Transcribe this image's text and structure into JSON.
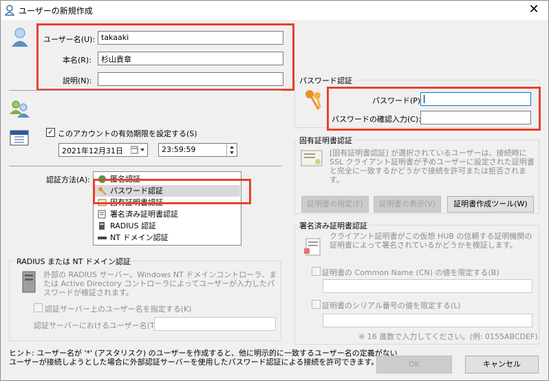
{
  "window": {
    "title": "ユーザーの新規作成",
    "close_label": "✕"
  },
  "user": {
    "username_label": "ユーザー名(U):",
    "username_value": "takaaki",
    "fullname_label": "本名(R):",
    "fullname_value": "杉山貴章",
    "note_label": "説明(N):",
    "note_value": ""
  },
  "expiry": {
    "checkbox_label": "このアカウントの有効期限を設定する(S)",
    "checked": "✓",
    "date_value": "2021年12月31日",
    "time_value": "23:59:59"
  },
  "auth": {
    "label": "認証方法(A):",
    "items": [
      {
        "label": "匿名認証"
      },
      {
        "label": "パスワード認証"
      },
      {
        "label": "固有証明書認証"
      },
      {
        "label": "署名済み証明書認証"
      },
      {
        "label": "RADIUS 認証"
      },
      {
        "label": "NT ドメイン認証"
      }
    ],
    "selected_index": 1
  },
  "radius": {
    "group_title": "RADIUS または NT ドメイン認証",
    "description": "外部の RADIUS サーバー、Windows NT ドメインコントローラ、または Active Directory コントローラによってユーザーが入力したパスワードが検証されます。",
    "checkbox_label": "認証サーバー上のユーザー名を指定する(K)",
    "server_user_label": "認証サーバーにおけるユーザー名(T):",
    "server_user_value": ""
  },
  "password": {
    "group_title": "パスワード認証",
    "password_label": "パスワード(P):",
    "password_value": "",
    "confirm_label": "パスワードの確認入力(C):",
    "confirm_value": ""
  },
  "cert": {
    "group_title": "固有証明書認証",
    "description": "[固有証明書認証] が選択されているユーザーは、接続時に SSL クライアント証明書が予めユーザーに設定された証明書と完全に一致するかどうかで接続を許可または拒否されます。",
    "specify_button": "証明書の指定(E)",
    "view_button": "証明書の表示(V)",
    "tool_button": "証明書作成ツール(W)"
  },
  "signed": {
    "group_title": "署名済み証明書認証",
    "description": "クライアント証明書がこの仮想 HUB の信頼する証明機関の証明書によって署名されているかどうかを検証します。",
    "cn_checkbox_label": "証明書の Common Name (CN) の値を限定する(B)",
    "cn_value": "",
    "serial_checkbox_label": "証明書のシリアル番号の値を限定する(L)",
    "serial_value": "",
    "serial_hint": "※ 16 進数で入力してください。(例: 0155ABCDEF)"
  },
  "hint": {
    "line1": "ヒント: ユーザー名が '*' (アスタリスク) のユーザーを作成すると、他に明示的に一致するユーザー名の定義がない",
    "line2": "ユーザーが接続しようとした場合に外部認証サーバーを使用したパスワード認証による接続を許可できます。"
  },
  "buttons": {
    "ok": "OK",
    "cancel": "キャンセル"
  },
  "colors": {
    "highlight": "#e8412c",
    "disabled_text": "#8c8c8c"
  }
}
